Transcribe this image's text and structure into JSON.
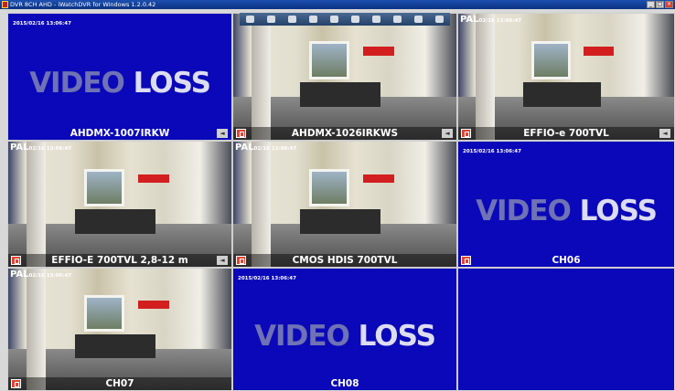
{
  "window": {
    "title": "DVR 8CH AHD - iWatchDVR for Windows 1.2.0.42",
    "buttons": [
      "_",
      "□",
      "×"
    ]
  },
  "toolbar": {
    "icons": [
      "lock-icon",
      "info-icon",
      "chat-icon",
      "camera-icon",
      "disk-icon",
      "monitor-icon",
      "key-icon",
      "screen-icon",
      "layout-icon",
      "minimize-icon"
    ]
  },
  "tiles": [
    {
      "type": "loss",
      "timestamp": "2015/02/16 13:06:47",
      "loss_a": "VIDEO",
      "loss_b": "LOSS",
      "label": "AHDMX-1007IRKW",
      "rec": false,
      "arrow": "◄"
    },
    {
      "type": "video",
      "label": "AHDMX-1026IRKWS",
      "rec": true,
      "arrow": "◄"
    },
    {
      "type": "video",
      "pal": "PAL",
      "pal_date": "02/16 13:06:47",
      "label": "EFFIO-e 700TVL",
      "rec": true,
      "arrow": "◄"
    },
    {
      "type": "video",
      "pal": "PAL",
      "pal_date": "02/16 13:06:47",
      "label": "EFFIO-E 700TVL 2,8-12 m",
      "rec": true,
      "arrow": "◄"
    },
    {
      "type": "video",
      "pal": "PAL",
      "pal_date": "02/16 13:06:47",
      "label": "CMOS HDIS 700TVL",
      "rec": true
    },
    {
      "type": "loss",
      "timestamp": "2015/02/16 13:06:47",
      "loss_a": "VIDEO",
      "loss_b": "LOSS",
      "label": "CH06",
      "rec": true
    },
    {
      "type": "video",
      "pal": "PAL",
      "pal_date": "02/16 13:06:47",
      "label": "CH07",
      "rec": true
    },
    {
      "type": "loss",
      "timestamp": "2015/02/16 13:06:47",
      "loss_a": "VIDEO",
      "loss_b": "LOSS",
      "label": "CH08",
      "rec": false
    },
    {
      "type": "empty"
    }
  ]
}
